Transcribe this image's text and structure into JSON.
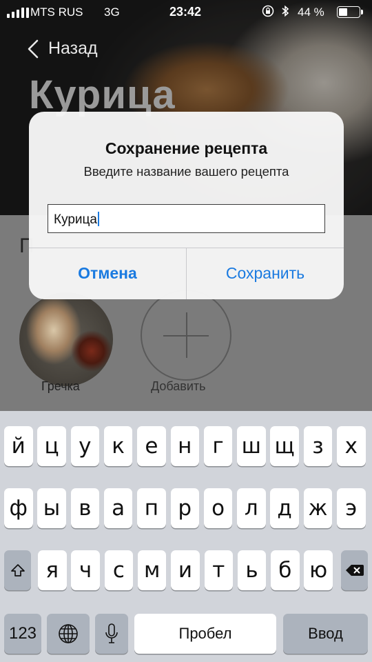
{
  "status_bar": {
    "carrier": "MTS RUS",
    "network": "3G",
    "time": "23:42",
    "battery_percent": "44 %",
    "battery_level": 0.44
  },
  "nav": {
    "back_label": "Назад"
  },
  "hero": {
    "title": "Курица"
  },
  "section": {
    "partial_heading": "П"
  },
  "recipes": [
    {
      "label": "Гречка"
    }
  ],
  "add_button": {
    "label": "Добавить"
  },
  "alert": {
    "title": "Сохранение рецепта",
    "message": "Введите название вашего рецепта",
    "input_value": "Курица",
    "cancel_label": "Отмена",
    "save_label": "Сохранить"
  },
  "keyboard": {
    "row1": [
      "й",
      "ц",
      "у",
      "к",
      "е",
      "н",
      "г",
      "ш",
      "щ",
      "з",
      "х"
    ],
    "row2": [
      "ф",
      "ы",
      "в",
      "а",
      "п",
      "р",
      "о",
      "л",
      "д",
      "ж",
      "э"
    ],
    "row3": [
      "я",
      "ч",
      "с",
      "м",
      "и",
      "т",
      "ь",
      "б",
      "ю"
    ],
    "numbers_label": "123",
    "space_label": "Пробел",
    "return_label": "Ввод"
  },
  "colors": {
    "accent": "#1a7ae0",
    "keyboard_bg": "#d1d4da",
    "function_key": "#acb3bd"
  }
}
